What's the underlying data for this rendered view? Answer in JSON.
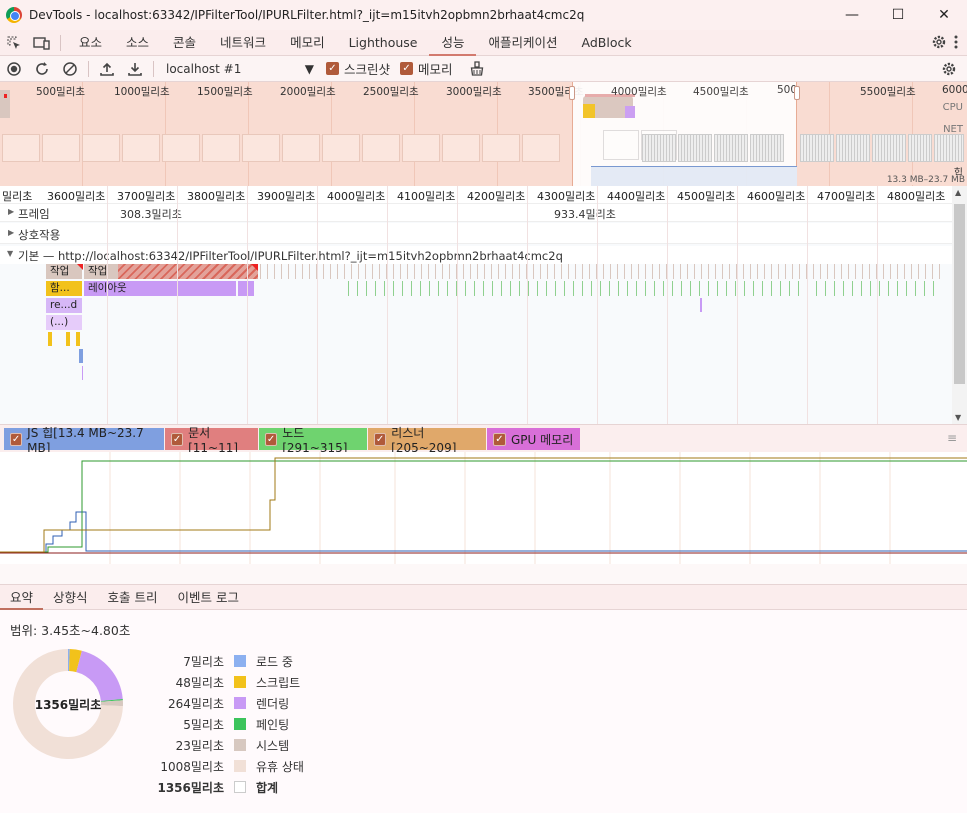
{
  "window": {
    "title": "DevTools - localhost:63342/IPFilterTool/IPURLFilter.html?_ijt=m15itvh2opbmn2brhaat4cmc2q",
    "minimize": "—",
    "maximize": "☐",
    "close": "✕"
  },
  "tabs": [
    "요소",
    "소스",
    "콘솔",
    "네트워크",
    "메모리",
    "Lighthouse",
    "성능",
    "애플리케이션",
    "AdBlock"
  ],
  "active_tab": "성능",
  "toolbar": {
    "target": "localhost #1",
    "screenshots_label": "스크린샷",
    "memory_label": "메모리"
  },
  "overview": {
    "ticks": [
      "500밀리초",
      "1000밀리초",
      "1500밀리초",
      "2000밀리초",
      "2500밀리초",
      "3000밀리초",
      "3500밀리초",
      "4000밀리초",
      "4500밀리초",
      "500",
      "5500밀리초",
      "6000"
    ],
    "cpu_label": "CPU",
    "net_label": "NET",
    "heap_label": "힙",
    "heap_range": "13.3 MB–23.7 MB"
  },
  "ruler": [
    "밀리초",
    "3600밀리초",
    "3700밀리초",
    "3800밀리초",
    "3900밀리초",
    "4000밀리초",
    "4100밀리초",
    "4200밀리초",
    "4300밀리초",
    "4400밀리초",
    "4500밀리초",
    "4600밀리초",
    "4700밀리초",
    "4800밀리초"
  ],
  "tracks": {
    "frames_label": "프레임",
    "frame_times": [
      "308.3밀리초",
      "933.4밀리초"
    ],
    "interactions_label": "상호작용",
    "main_label": "기본 — http://localhost:63342/IPFilterTool/IPURLFilter.html?_ijt=m15itvh2opbmn2brhaat4cmc2q",
    "task_short": "작업",
    "task_long": "작업",
    "func_call": "함...",
    "layout": "레이아웃",
    "recalc": "re...d",
    "anon": "(...)"
  },
  "counters": [
    {
      "label": "JS 힙[13.4 MB~23.7 MB]",
      "color": "#7f9fe0"
    },
    {
      "label": "문서[11~11]",
      "color": "#e07f7f"
    },
    {
      "label": "노드[291~315]",
      "color": "#6fd36f"
    },
    {
      "label": "리스너[205~209]",
      "color": "#e0a86a"
    },
    {
      "label": "GPU 메모리",
      "color": "#d86fd8"
    }
  ],
  "bottom_tabs": [
    "요약",
    "상향식",
    "호출 트리",
    "이벤트 로그"
  ],
  "summary": {
    "range": "범위: 3.45초~4.80초",
    "total_center": "1356밀리초",
    "items": [
      {
        "value": "7밀리초",
        "name": "로드 중",
        "color": "#8cb0f0",
        "ms": 7
      },
      {
        "value": "48밀리초",
        "name": "스크립트",
        "color": "#f2c21b",
        "ms": 48
      },
      {
        "value": "264밀리초",
        "name": "렌더링",
        "color": "#c89af5",
        "ms": 264
      },
      {
        "value": "5밀리초",
        "name": "페인팅",
        "color": "#3cc45c",
        "ms": 5
      },
      {
        "value": "23밀리초",
        "name": "시스템",
        "color": "#d7c8c0",
        "ms": 23
      },
      {
        "value": "1008밀리초",
        "name": "유휴 상태",
        "color": "#f1e0d7",
        "ms": 1008
      }
    ],
    "total": {
      "value": "1356밀리초",
      "name": "합계"
    }
  }
}
